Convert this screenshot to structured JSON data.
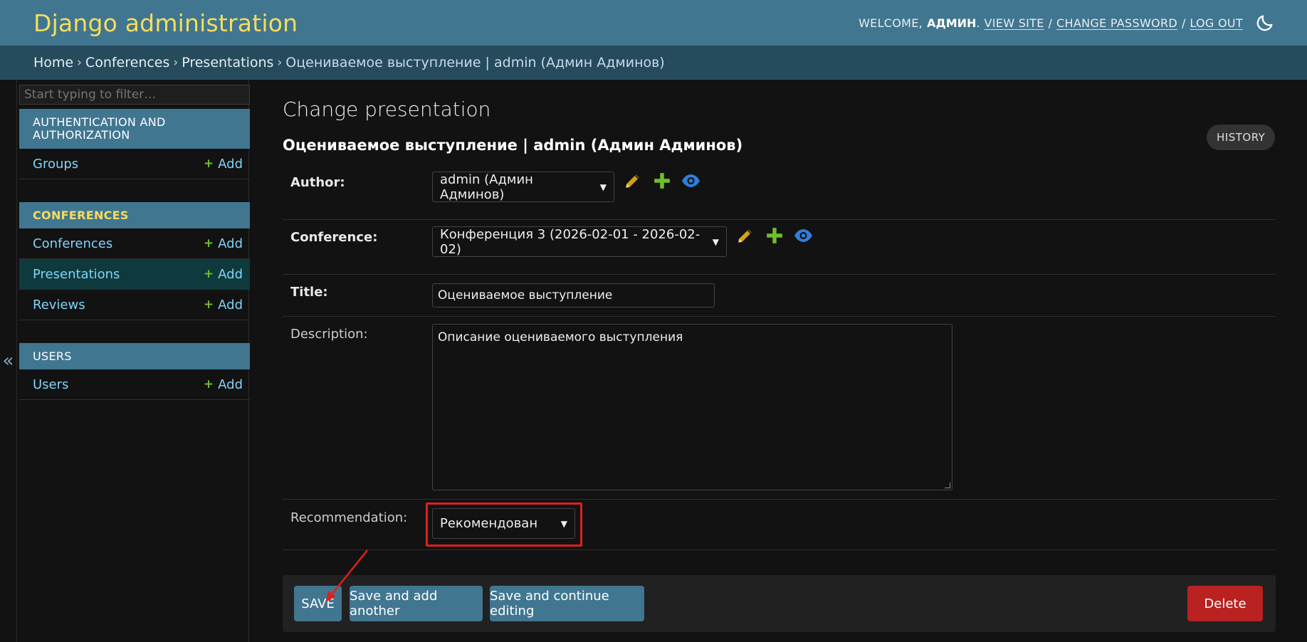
{
  "header": {
    "branding": "Django administration",
    "welcome": "WELCOME,",
    "username": "АДМИН",
    "dot": ".",
    "view_site": "VIEW SITE",
    "change_password": "CHANGE PASSWORD",
    "log_out": "LOG OUT",
    "sep": "/",
    "theme_icon": "moon-icon"
  },
  "breadcrumbs": {
    "home": "Home",
    "conferences": "Conferences",
    "presentations": "Presentations",
    "current": "Оцениваемое выступление | admin (Админ Админов)",
    "separator": "›"
  },
  "sidebar": {
    "toggle": "«",
    "filter_placeholder": "Start typing to filter…",
    "modules": [
      {
        "caption": "AUTHENTICATION AND AUTHORIZATION",
        "models": [
          {
            "name": "Groups",
            "add": "Add"
          }
        ]
      },
      {
        "caption": "CONFERENCES",
        "models": [
          {
            "name": "Conferences",
            "add": "Add"
          },
          {
            "name": "Presentations",
            "add": "Add"
          },
          {
            "name": "Reviews",
            "add": "Add"
          }
        ]
      },
      {
        "caption": "USERS",
        "models": [
          {
            "name": "Users",
            "add": "Add"
          }
        ]
      }
    ],
    "plus_glyph": "+"
  },
  "content": {
    "page_title": "Change presentation",
    "object_title": "Оцениваемое выступление | admin (Админ Админов)",
    "history": "HISTORY",
    "fields": {
      "author": {
        "label": "Author:",
        "value": "admin (Админ Админов)"
      },
      "conference": {
        "label": "Conference:",
        "value": "Конференция 3 (2026-02-01 - 2026-02-02)"
      },
      "title": {
        "label": "Title:",
        "value": "Оцениваемое выступление"
      },
      "description": {
        "label": "Description:",
        "value": "Описание оцениваемого выступления"
      },
      "recommendation": {
        "label": "Recommendation:",
        "value": "Рекомендован"
      }
    },
    "related_icons": [
      "pencil-icon",
      "plus-icon",
      "eye-icon"
    ]
  },
  "submit_row": {
    "save": "SAVE",
    "save_add_another": "Save and add another",
    "save_continue": "Save and continue editing",
    "delete": "Delete"
  },
  "colors": {
    "header_bg": "#417690",
    "breadcrumb_bg": "#264b5d",
    "branding": "#f5dd5d",
    "link": "#81d4fa",
    "add_plus": "#70bf2b",
    "delete_button": "#ba2121",
    "highlight": "#e01f1f",
    "edit_icon": "#d4a017",
    "view_icon": "#2f7fd8"
  }
}
